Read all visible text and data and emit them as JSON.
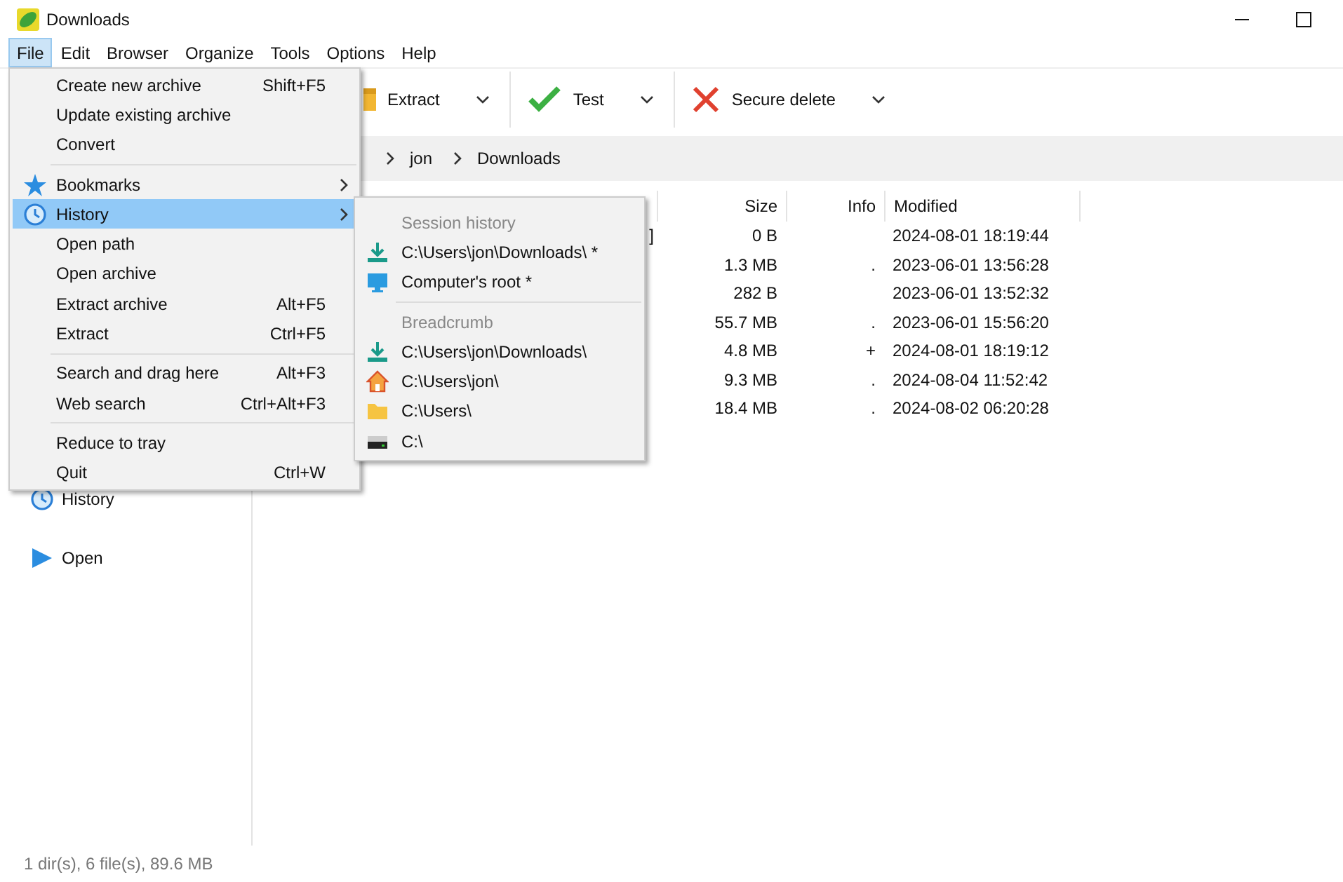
{
  "window": {
    "title": "Downloads"
  },
  "menubar": [
    {
      "label": "File",
      "selected": true
    },
    {
      "label": "Edit",
      "selected": false
    },
    {
      "label": "Browser",
      "selected": false
    },
    {
      "label": "Organize",
      "selected": false
    },
    {
      "label": "Tools",
      "selected": false
    },
    {
      "label": "Options",
      "selected": false
    },
    {
      "label": "Help",
      "selected": false
    }
  ],
  "toolbar": [
    {
      "label": "Extract"
    },
    {
      "label": "Test"
    },
    {
      "label": "Secure delete"
    }
  ],
  "breadcrumb": [
    "jon",
    "Downloads"
  ],
  "sidebar": {
    "items": [
      {
        "label": "History"
      },
      {
        "label": "Open"
      }
    ]
  },
  "table": {
    "columns": [
      "Size",
      "Info",
      "Modified"
    ],
    "rows": [
      {
        "name": "]",
        "size": "0 B",
        "info": "",
        "modified": "2024-08-01 18:19:44"
      },
      {
        "size": "1.3 MB",
        "info": ".",
        "modified": "2023-06-01 13:56:28"
      },
      {
        "size": "282 B",
        "info": "",
        "modified": "2023-06-01 13:52:32"
      },
      {
        "size": "55.7 MB",
        "info": ".",
        "modified": "2023-06-01 15:56:20"
      },
      {
        "size": "4.8 MB",
        "info": "+",
        "modified": "2024-08-01 18:19:12"
      },
      {
        "size": "9.3 MB",
        "info": ".",
        "modified": "2024-08-04 11:52:42"
      },
      {
        "size": "18.4 MB",
        "info": ".",
        "modified": "2024-08-02 06:20:28"
      }
    ]
  },
  "file_menu": {
    "items": [
      {
        "kind": "item",
        "label": "Create new archive",
        "shortcut": "Shift+F5",
        "selected": false
      },
      {
        "kind": "item",
        "label": "Update existing archive",
        "selected": false
      },
      {
        "kind": "item",
        "label": "Convert",
        "selected": false
      },
      {
        "kind": "separator"
      },
      {
        "kind": "item",
        "label": "Bookmarks",
        "submenu": true,
        "selected": false
      },
      {
        "kind": "item",
        "label": "History",
        "submenu": true,
        "selected": true
      },
      {
        "kind": "item",
        "label": "Open path",
        "selected": false
      },
      {
        "kind": "item",
        "label": "Open archive",
        "selected": false
      },
      {
        "kind": "item",
        "label": "Extract archive",
        "shortcut": "Alt+F5",
        "selected": false
      },
      {
        "kind": "item",
        "label": "Extract",
        "shortcut": "Ctrl+F5",
        "selected": false
      },
      {
        "kind": "separator"
      },
      {
        "kind": "item",
        "label": "Search and drag here",
        "shortcut": "Alt+F3",
        "selected": false
      },
      {
        "kind": "item",
        "label": "Web search",
        "shortcut": "Ctrl+Alt+F3",
        "selected": false
      },
      {
        "kind": "separator"
      },
      {
        "kind": "item",
        "label": "Reduce to tray",
        "selected": false
      },
      {
        "kind": "item",
        "label": "Quit",
        "shortcut": "Ctrl+W",
        "selected": false
      }
    ]
  },
  "history_submenu": {
    "items": [
      {
        "kind": "header",
        "label": "Session history"
      },
      {
        "kind": "item",
        "label": "C:\\Users\\jon\\Downloads\\ *"
      },
      {
        "kind": "item",
        "label": "Computer's root *"
      },
      {
        "kind": "separator"
      },
      {
        "kind": "header",
        "label": "Breadcrumb"
      },
      {
        "kind": "item",
        "label": "C:\\Users\\jon\\Downloads\\"
      },
      {
        "kind": "item",
        "label": "C:\\Users\\jon\\"
      },
      {
        "kind": "item",
        "label": "C:\\Users\\"
      },
      {
        "kind": "item",
        "label": "C:\\"
      }
    ]
  },
  "status_bar": "1 dir(s), 6 file(s), 89.6 MB"
}
